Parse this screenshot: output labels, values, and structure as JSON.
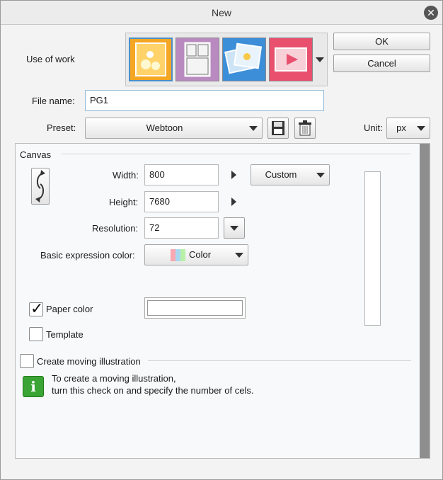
{
  "window": {
    "title": "New",
    "close_glyph": "✕"
  },
  "use_of_work": {
    "label": "Use of work",
    "icons": [
      {
        "name": "illustration-icon",
        "color": "#f5a623",
        "selected": true
      },
      {
        "name": "comic-icon",
        "color": "#b98ac0",
        "selected": false
      },
      {
        "name": "show-all-paintings-icon",
        "color": "#3d8ed8",
        "selected": false
      },
      {
        "name": "animation-icon",
        "color": "#e8506e",
        "selected": false
      }
    ]
  },
  "buttons": {
    "ok": "OK",
    "cancel": "Cancel"
  },
  "file_name": {
    "label": "File name:",
    "value": "PG1"
  },
  "preset": {
    "label": "Preset:",
    "value": "Webtoon"
  },
  "unit": {
    "label": "Unit:",
    "value": "px"
  },
  "canvas": {
    "section_label": "Canvas",
    "width": {
      "label": "Width:",
      "value": "800"
    },
    "height": {
      "label": "Height:",
      "value": "7680"
    },
    "resolution": {
      "label": "Resolution:",
      "value": "72"
    },
    "size_preset": "Custom",
    "expression": {
      "label": "Basic expression color:",
      "value": "Color"
    },
    "paper_color": {
      "label": "Paper color",
      "checked": true
    },
    "template": {
      "label": "Template",
      "checked": false
    }
  },
  "moving": {
    "label": "Create moving illustration",
    "checked": false,
    "info_glyph": "i",
    "info_line1": "To create a moving illustration,",
    "info_line2": "turn this check on and specify the number of cels."
  }
}
